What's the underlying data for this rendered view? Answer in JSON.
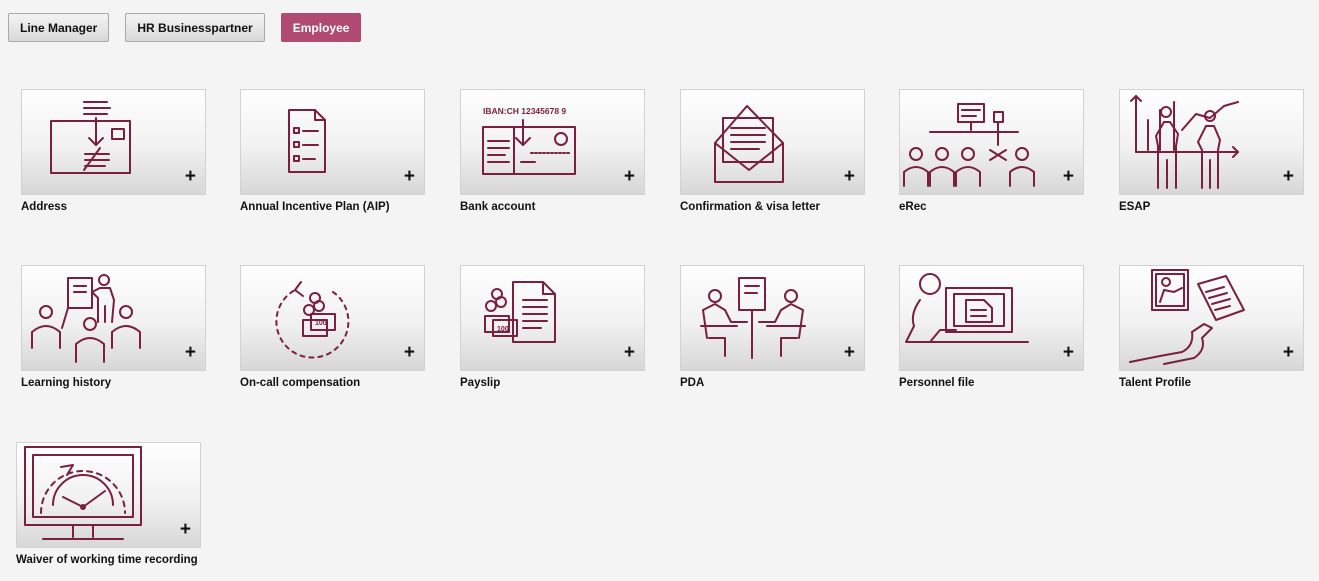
{
  "roles": [
    {
      "label": "Line Manager",
      "active": false
    },
    {
      "label": "HR Businesspartner",
      "active": false
    },
    {
      "label": "Employee",
      "active": true
    }
  ],
  "accent_color": "#b04a72",
  "icon_color": "#7a1f3e",
  "plus_label": "+",
  "tiles": [
    {
      "label": "Address",
      "icon": "mail-envelope-icon"
    },
    {
      "label": "Annual Incentive Plan (AIP)",
      "icon": "checklist-document-icon"
    },
    {
      "label": "Bank account",
      "icon": "bank-card-icon",
      "icon_text": "IBAN:CH 12345678 9"
    },
    {
      "label": "Confirmation & visa letter",
      "icon": "open-envelope-letter-icon"
    },
    {
      "label": "eRec",
      "icon": "recruiting-meeting-icon"
    },
    {
      "label": "ESAP",
      "icon": "people-chart-icon"
    },
    {
      "label": "Learning history",
      "icon": "classroom-presentation-icon"
    },
    {
      "label": "On-call compensation",
      "icon": "clock-money-icon",
      "icon_text": "100"
    },
    {
      "label": "Payslip",
      "icon": "money-document-icon",
      "icon_text": "100"
    },
    {
      "label": "PDA",
      "icon": "discussion-flipchart-icon"
    },
    {
      "label": "Personnel file",
      "icon": "person-computer-icon"
    },
    {
      "label": "Talent Profile",
      "icon": "hand-documents-icon"
    },
    {
      "label": "Waiver of working time recording",
      "icon": "monitor-clock-icon"
    }
  ]
}
